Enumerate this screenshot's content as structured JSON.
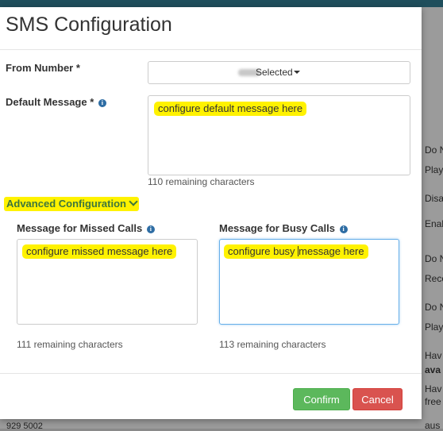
{
  "background": {
    "right_items": [
      "Do N",
      "Play",
      "Disa",
      "Enab",
      "Do N",
      "Reco",
      "Do N",
      "Play",
      "Hav",
      "ava",
      "Hav",
      "free",
      "aus"
    ],
    "bottom_text": "929 5002"
  },
  "modal": {
    "title": "SMS Configuration",
    "from_number": {
      "label": "From Number *",
      "value": "Selected"
    },
    "default_message": {
      "label": "Default Message *",
      "value": "configure default message here",
      "remaining": "110 remaining characters"
    },
    "advanced_label": "Advanced Configuration",
    "missed": {
      "label": "Message for Missed Calls",
      "value": "configure missed message here",
      "remaining": "111 remaining characters"
    },
    "busy": {
      "label": "Message for Busy Calls",
      "value_before_cursor": "configure busy ",
      "value_after_cursor": "message here",
      "remaining": "113 remaining characters"
    },
    "confirm_label": "Confirm",
    "cancel_label": "Cancel"
  },
  "colors": {
    "highlight": "#fff200",
    "confirm": "#5cb85c",
    "cancel": "#d9534f",
    "advanced": "#3c763d",
    "info_icon": "#2e6da4"
  }
}
